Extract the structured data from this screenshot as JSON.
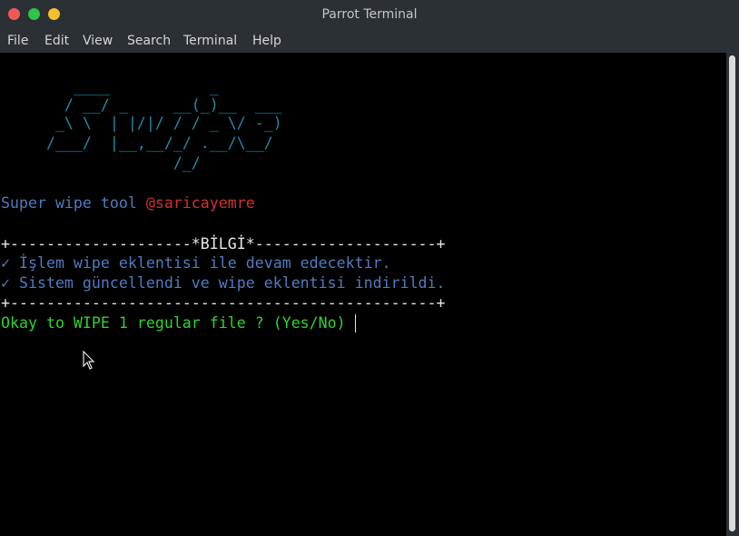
{
  "window": {
    "title": "Parrot Terminal"
  },
  "menu": [
    "File",
    "Edit",
    "View",
    "Search",
    "Terminal",
    "Help"
  ],
  "terminal": {
    "ascii_art": [
      "        ____           _",
      "       / __/ _     __(_)__  ___",
      "      _\\ \\  | |/|/ / / _ \\/ -_)",
      "     /___/  |__,__/_/ .__/\\__/",
      "                   /_/"
    ],
    "tool_label": "Super wipe tool",
    "tool_handle": "@saricayemre",
    "box_top_left": "+--------------------",
    "box_title": "*BİLGİ*",
    "box_top_right": "--------------------+",
    "info_lines": [
      "✓ İşlem wipe eklentisi ile devam edecektir.",
      "✓ Sistem güncellendi ve wipe eklentisi indirildi."
    ],
    "box_bottom": "+-----------------------------------------------+",
    "prompt": "Okay to WIPE 1 regular file ? (Yes/No) "
  },
  "colors": {
    "ascii": "#1f8ba6",
    "text_blue": "#4e7cbf",
    "handle_red": "#d0312d",
    "prompt_green": "#2fd32f"
  },
  "icons": [
    "close-dot-icon",
    "minimize-dot-icon",
    "maximize-dot-icon",
    "mouse-pointer-icon"
  ]
}
